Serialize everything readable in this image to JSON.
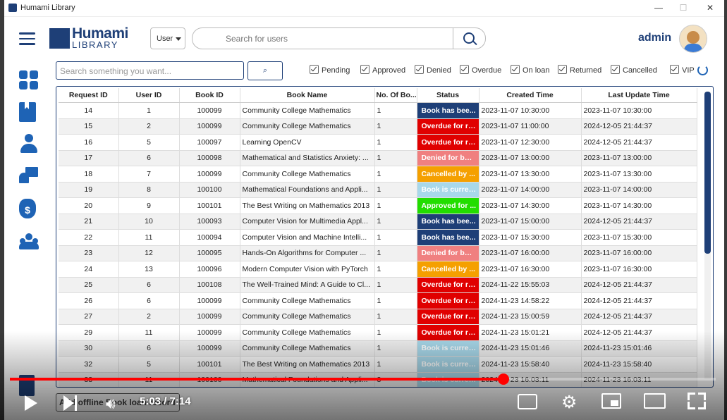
{
  "window": {
    "title": "Humami Library",
    "controls": [
      "—",
      "☐",
      "✕"
    ]
  },
  "header": {
    "logo_line1": "Humami",
    "logo_line2": "LIBRARY",
    "search_type": "User",
    "search_placeholder": "Search for users",
    "admin_name": "admin"
  },
  "filter": {
    "placeholder": "Search something you want...",
    "checkboxes": [
      {
        "label": "Pending",
        "checked": true
      },
      {
        "label": "Approved",
        "checked": true
      },
      {
        "label": "Denied",
        "checked": true
      },
      {
        "label": "Overdue",
        "checked": true
      },
      {
        "label": "On loan",
        "checked": true
      },
      {
        "label": "Returned",
        "checked": true
      },
      {
        "label": "Cancelled",
        "checked": true
      },
      {
        "label": "VIP",
        "checked": true
      }
    ]
  },
  "table": {
    "columns": [
      "Request ID",
      "User ID",
      "Book ID",
      "Book Name",
      "No. Of Bo...",
      "Status",
      "Created Time",
      "Last Update Time"
    ],
    "rows": [
      [
        "14",
        "1",
        "100099",
        "Community College Mathematics",
        "1",
        "Book has bee...",
        "2023-11-07 10:30:00",
        "2023-11-07 10:30:00"
      ],
      [
        "15",
        "2",
        "100099",
        "Community College Mathematics",
        "1",
        "Overdue for re...",
        "2023-11-07 11:00:00",
        "2024-12-05 21:44:37"
      ],
      [
        "16",
        "5",
        "100097",
        "Learning OpenCV",
        "1",
        "Overdue for re...",
        "2023-11-07 12:30:00",
        "2024-12-05 21:44:37"
      ],
      [
        "17",
        "6",
        "100098",
        "Mathematical and Statistics Anxiety: ...",
        "1",
        "Denied for bor...",
        "2023-11-07 13:00:00",
        "2023-11-07 13:00:00"
      ],
      [
        "18",
        "7",
        "100099",
        "Community College Mathematics",
        "1",
        "Cancelled by ...",
        "2023-11-07 13:30:00",
        "2023-11-07 13:30:00"
      ],
      [
        "19",
        "8",
        "100100",
        "Mathematical Foundations and Appli...",
        "1",
        "Book is curren...",
        "2023-11-07 14:00:00",
        "2023-11-07 14:00:00"
      ],
      [
        "20",
        "9",
        "100101",
        "The Best Writing on Mathematics 2013",
        "1",
        "Approved for ...",
        "2023-11-07 14:30:00",
        "2023-11-07 14:30:00"
      ],
      [
        "21",
        "10",
        "100093",
        "Computer Vision for Multimedia Appl...",
        "1",
        "Book has bee...",
        "2023-11-07 15:00:00",
        "2024-12-05 21:44:37"
      ],
      [
        "22",
        "11",
        "100094",
        "Computer Vision and Machine Intelli...",
        "1",
        "Book has bee...",
        "2023-11-07 15:30:00",
        "2023-11-07 15:30:00"
      ],
      [
        "23",
        "12",
        "100095",
        "Hands-On Algorithms for Computer ...",
        "1",
        "Denied for bor...",
        "2023-11-07 16:00:00",
        "2023-11-07 16:00:00"
      ],
      [
        "24",
        "13",
        "100096",
        "Modern Computer Vision with PyTorch",
        "1",
        "Cancelled by ...",
        "2023-11-07 16:30:00",
        "2023-11-07 16:30:00"
      ],
      [
        "25",
        "6",
        "100108",
        "The Well-Trained Mind: A Guide to Cl...",
        "1",
        "Overdue for re...",
        "2024-11-22 15:55:03",
        "2024-12-05 21:44:37"
      ],
      [
        "26",
        "6",
        "100099",
        "Community College Mathematics",
        "1",
        "Overdue for re...",
        "2024-11-23 14:58:22",
        "2024-12-05 21:44:37"
      ],
      [
        "27",
        "2",
        "100099",
        "Community College Mathematics",
        "1",
        "Overdue for re...",
        "2024-11-23 15:00:59",
        "2024-12-05 21:44:37"
      ],
      [
        "29",
        "11",
        "100099",
        "Community College Mathematics",
        "1",
        "Overdue for re...",
        "2024-11-23 15:01:21",
        "2024-12-05 21:44:37"
      ],
      [
        "30",
        "6",
        "100099",
        "Community College Mathematics",
        "1",
        "Book is curren...",
        "2024-11-23 15:01:46",
        "2024-11-23 15:01:46"
      ],
      [
        "32",
        "5",
        "100101",
        "The Best Writing on Mathematics 2013",
        "1",
        "Book is curren...",
        "2024-11-23 15:58:40",
        "2024-11-23 15:58:40"
      ],
      [
        "33",
        "11",
        "100100",
        "Mathematical Foundations and Appli...",
        "3",
        "Book is curren...",
        "2024-11-23 16:03:11",
        "2024-11-23 16:03:11"
      ]
    ],
    "status_colors": {
      "Book has bee...": "#1e3f77",
      "Overdue for re...": "#e00000",
      "Denied for bor...": "#f08080",
      "Cancelled by ...": "#f5a000",
      "Book is curren...": "#a8d8ea",
      "Approved for ...": "#22dd00"
    }
  },
  "bottom": {
    "button_label": "Add offline Book loan record"
  },
  "video": {
    "time_current": "5:03",
    "time_total": "7:14",
    "progress": 0.699
  },
  "colors": {
    "brand": "#1e3f77",
    "accent": "#1e63b5"
  }
}
